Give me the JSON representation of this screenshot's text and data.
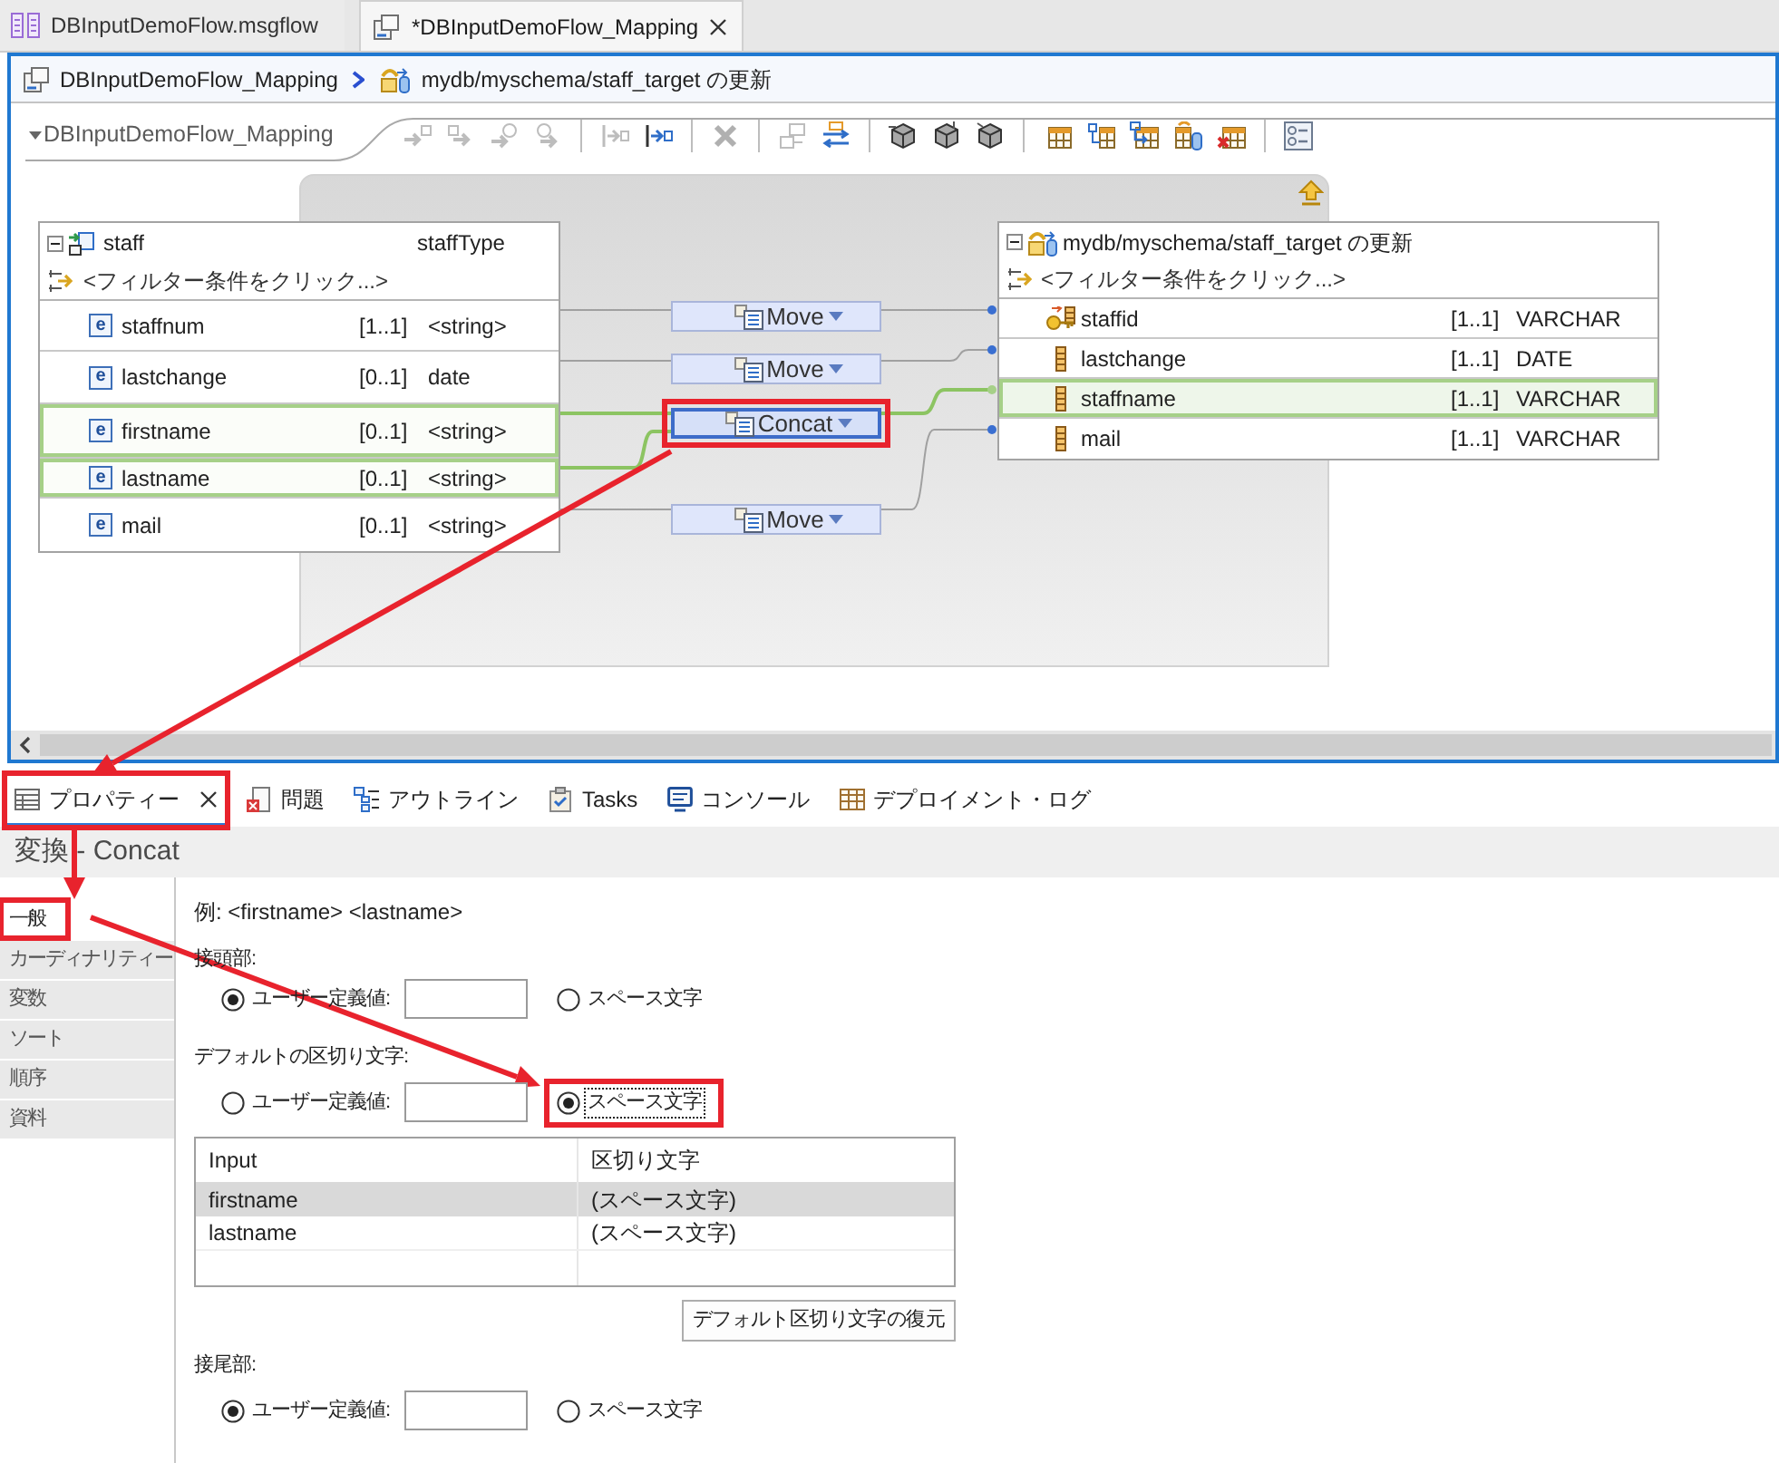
{
  "editor_tabs": [
    {
      "label": "DBInputDemoFlow.msgflow",
      "selected": false,
      "closable": false
    },
    {
      "label": "*DBInputDemoFlow_Mapping",
      "selected": true,
      "closable": true
    }
  ],
  "breadcrumb": [
    "DBInputDemoFlow_Mapping",
    "mydb/myschema/staff_target の更新"
  ],
  "toolbar": {
    "map_name": "DBInputDemoFlow_Mapping",
    "expanded": true,
    "groups": [
      [
        {
          "disabled": true
        },
        {
          "disabled": true
        },
        {
          "disabled": true
        },
        {
          "disabled": true
        }
      ],
      [
        {
          "disabled": true
        },
        {
          "disabled": false
        }
      ],
      [
        {
          "disabled": true
        }
      ],
      [
        {
          "disabled": true
        },
        {
          "disabled": false
        }
      ],
      [
        {
          "disabled": false
        },
        {
          "disabled": false
        },
        {
          "disabled": false
        }
      ],
      [
        {
          "disabled": false
        },
        {
          "disabled": false
        },
        {
          "disabled": false
        },
        {
          "disabled": false
        },
        {
          "disabled": false
        }
      ],
      [
        {
          "disabled": false
        }
      ]
    ]
  },
  "source": {
    "name": "staff",
    "type": "staffType",
    "expanded": true,
    "filter": "<フィルター条件をクリック...>",
    "rows": [
      {
        "badge": "e",
        "name": "staffnum",
        "cardinality": "[1..1]",
        "type": "<string>",
        "highlighted": false
      },
      {
        "badge": "e",
        "name": "lastchange",
        "cardinality": "[0..1]",
        "type": "date",
        "highlighted": false
      },
      {
        "badge": "e",
        "name": "firstname",
        "cardinality": "[0..1]",
        "type": "<string>",
        "highlighted": true
      },
      {
        "badge": "e",
        "name": "lastname",
        "cardinality": "[0..1]",
        "type": "<string>",
        "highlighted": true
      },
      {
        "badge": "e",
        "name": "mail",
        "cardinality": "[0..1]",
        "type": "<string>",
        "highlighted": false
      }
    ]
  },
  "transforms": [
    {
      "label": "Move",
      "selected": false,
      "annotated": false
    },
    {
      "label": "Move",
      "selected": false,
      "annotated": false
    },
    {
      "label": "Concat",
      "selected": true,
      "annotated": true
    },
    {
      "label": "Move",
      "selected": false,
      "annotated": false
    }
  ],
  "target": {
    "name": "mydb/myschema/staff_target の更新",
    "expanded": true,
    "filter": "<フィルター条件をクリック...>",
    "rows": [
      {
        "kind": "key",
        "name": "staffid",
        "cardinality": "[1..1]",
        "type": "VARCHAR",
        "highlighted": false
      },
      {
        "kind": "column",
        "name": "lastchange",
        "cardinality": "[1..1]",
        "type": "DATE",
        "highlighted": false
      },
      {
        "kind": "column",
        "name": "staffname",
        "cardinality": "[1..1]",
        "type": "VARCHAR",
        "highlighted": true
      },
      {
        "kind": "column",
        "name": "mail",
        "cardinality": "[1..1]",
        "type": "VARCHAR",
        "highlighted": false
      }
    ]
  },
  "views": [
    {
      "label": "プロパティー",
      "selected": true,
      "closable": true,
      "annotated": true
    },
    {
      "label": "問題",
      "selected": false,
      "closable": false,
      "annotated": false
    },
    {
      "label": "アウトライン",
      "selected": false,
      "closable": false,
      "annotated": false
    },
    {
      "label": "Tasks",
      "selected": false,
      "closable": false,
      "annotated": false
    },
    {
      "label": "コンソール",
      "selected": false,
      "closable": false,
      "annotated": false
    },
    {
      "label": "デプロイメント・ログ",
      "selected": false,
      "closable": false,
      "annotated": false
    }
  ],
  "properties": {
    "title": "変換 - Concat",
    "tabs": [
      {
        "label": "一般",
        "selected": true,
        "annotated": true
      },
      {
        "label": "カーディナリティー",
        "selected": false,
        "annotated": false
      },
      {
        "label": "変数",
        "selected": false,
        "annotated": false
      },
      {
        "label": "ソート",
        "selected": false,
        "annotated": false
      },
      {
        "label": "順序",
        "selected": false,
        "annotated": false
      },
      {
        "label": "資料",
        "selected": false,
        "annotated": false
      }
    ],
    "example": "例: <firstname> <lastname>",
    "sections": [
      {
        "label": "接頭部:",
        "options": [
          {
            "kind": "custom",
            "label": "ユーザー定義値:",
            "selected": true,
            "focused": false,
            "annotated": false
          },
          {
            "kind": "space",
            "label": "スペース文字",
            "selected": false,
            "focused": false,
            "annotated": false
          }
        ]
      },
      {
        "label": "デフォルトの区切り文字:",
        "options": [
          {
            "kind": "custom",
            "label": "ユーザー定義値:",
            "selected": false,
            "focused": false,
            "annotated": false
          },
          {
            "kind": "space",
            "label": "スペース文字",
            "selected": true,
            "focused": true,
            "annotated": true
          }
        ],
        "table": {
          "columns": [
            "Input",
            "区切り文字"
          ],
          "rows": [
            {
              "cells": [
                "firstname",
                "(スペース文字)"
              ],
              "selected": true
            },
            {
              "cells": [
                "lastname",
                "(スペース文字)"
              ],
              "selected": false
            }
          ]
        },
        "button": "デフォルト区切り文字の復元"
      },
      {
        "label": "接尾部:",
        "options": [
          {
            "kind": "custom",
            "label": "ユーザー定義値:",
            "selected": true,
            "focused": false,
            "annotated": false
          },
          {
            "kind": "space",
            "label": "スペース文字",
            "selected": false,
            "focused": false,
            "annotated": false
          }
        ]
      }
    ]
  }
}
